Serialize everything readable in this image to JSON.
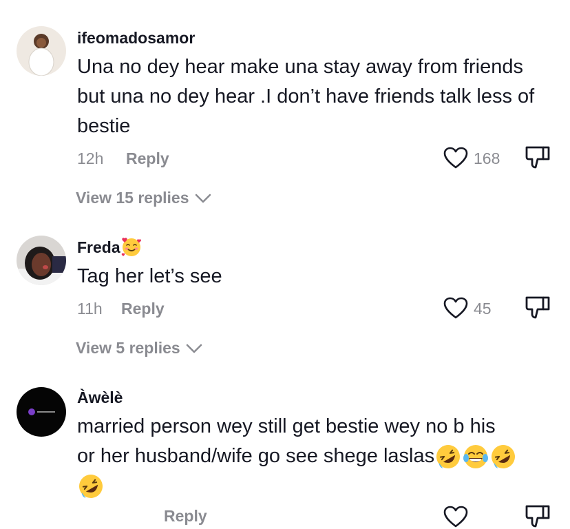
{
  "comments": [
    {
      "username": "ifeomadosamor",
      "text": "Una no dey hear make una stay away from friends but una no dey hear .I don’t have friends talk less of bestie",
      "time": "12h",
      "reply_label": "Reply",
      "likes": "168",
      "view_replies": "View 15 replies"
    },
    {
      "username": "Freda",
      "username_emoji": "smiling-face-with-hearts",
      "text": "Tag her let’s see",
      "time": "11h",
      "reply_label": "Reply",
      "likes": "45",
      "view_replies": "View 5 replies"
    },
    {
      "username": "Àwèlè",
      "text_line1": "married person wey still get bestie wey no b his",
      "text_line2": "or her husband/wife go see shege laslas",
      "emojis": [
        "rolling-on-floor-laughing",
        "face-with-tears-of-joy",
        "rolling-on-floor-laughing",
        "rolling-on-floor-laughing"
      ],
      "reply_label": "Reply"
    }
  ],
  "colors": {
    "text": "#161823",
    "secondary": "#8a8b91",
    "background": "#ffffff"
  }
}
